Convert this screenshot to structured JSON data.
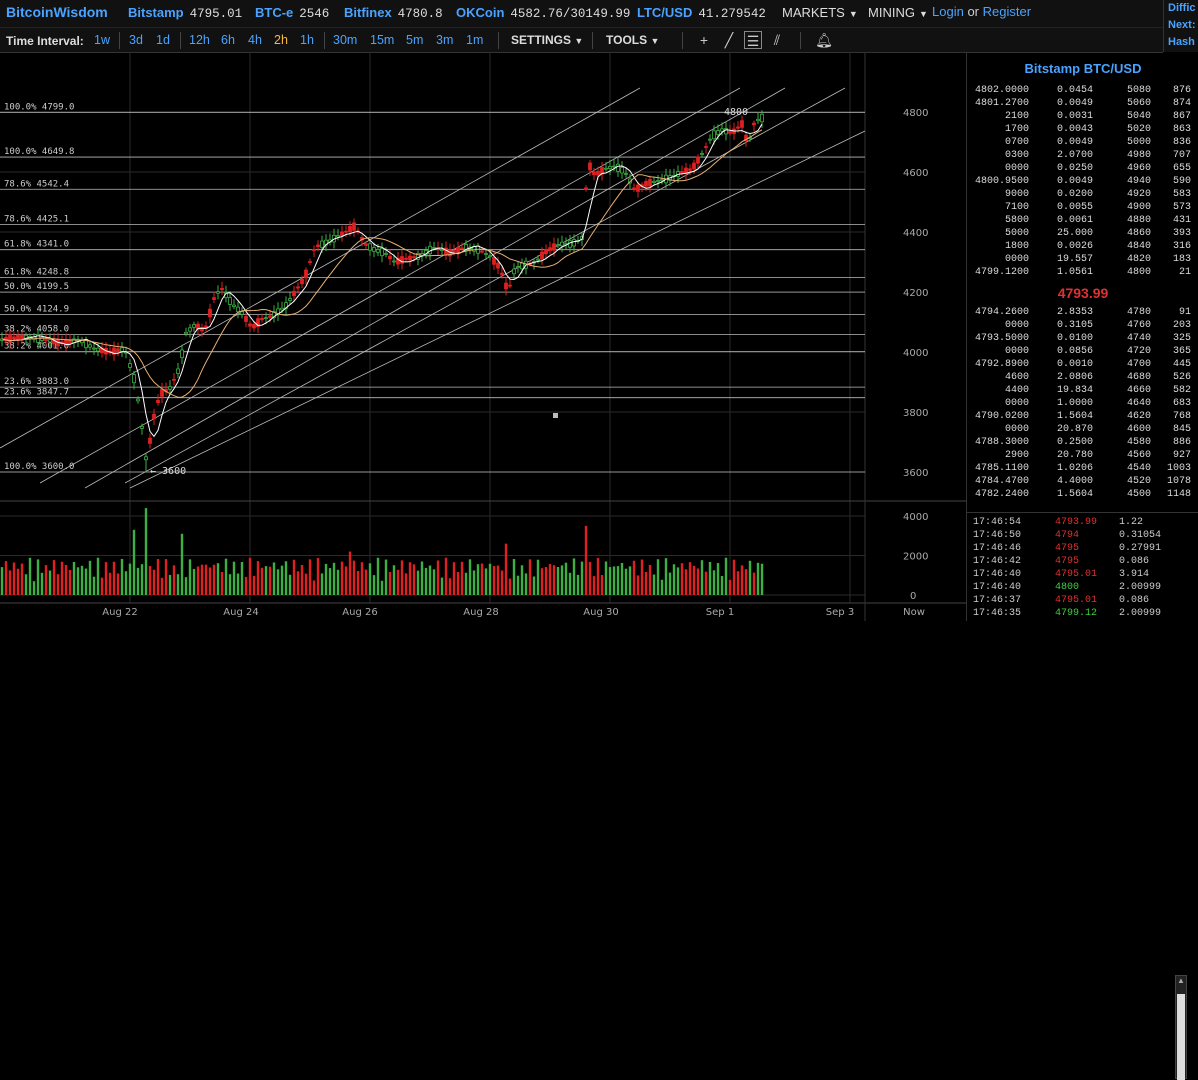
{
  "topbar": {
    "brand": "BitcoinWisdom",
    "exchanges": [
      {
        "name": "Bitstamp",
        "price": "4795.01"
      },
      {
        "name": "BTC-e",
        "price": "2546"
      },
      {
        "name": "Bitfinex",
        "price": "4780.8"
      },
      {
        "name": "OKCoin",
        "price": "4582.76/30149.99"
      },
      {
        "name": "LTC/USD",
        "price": "41.279542"
      }
    ],
    "markets_label": "MARKETS",
    "mining_label": "MINING",
    "login_label": "Login",
    "or_label": "or",
    "register_label": "Register",
    "side_lines": [
      "Diffic",
      "Next:",
      "Hash"
    ]
  },
  "toolbar": {
    "time_interval_label": "Time Interval:",
    "intervals": [
      "1w",
      "3d",
      "1d",
      "12h",
      "6h",
      "4h",
      "2h",
      "1h",
      "30m",
      "15m",
      "5m",
      "3m",
      "1m"
    ],
    "active_interval": "2h",
    "settings_label": "SETTINGS",
    "tools_label": "TOOLS"
  },
  "chart_data": {
    "type": "candlestick",
    "y_ticks": [
      "4800",
      "4600",
      "4400",
      "4200",
      "4000",
      "3800",
      "3600"
    ],
    "x_labels": [
      "Aug 22",
      "Aug 24",
      "Aug 26",
      "Aug 28",
      "Aug 30",
      "Sep 1",
      "Sep 3",
      "Now"
    ],
    "volume_ticks": [
      "4000",
      "2000",
      "0"
    ],
    "ylim": [
      3550,
      4900
    ],
    "volume_ylim": [
      0,
      4600
    ],
    "fib_levels": [
      {
        "label": "100.0% 4799.0",
        "price": 4799.0
      },
      {
        "label": "100.0% 4649.8",
        "price": 4649.8
      },
      {
        "label": "78.6% 4542.4",
        "price": 4542.4
      },
      {
        "label": "78.6% 4425.1",
        "price": 4425.1
      },
      {
        "label": "61.8% 4341.0",
        "price": 4341.0
      },
      {
        "label": "61.8% 4248.8",
        "price": 4248.8
      },
      {
        "label": "50.0% 4199.5",
        "price": 4199.5
      },
      {
        "label": "50.0% 4124.9",
        "price": 4124.9
      },
      {
        "label": "38.2% 4058.0",
        "price": 4058.0
      },
      {
        "label": "38.2% 4001.0",
        "price": 4001.0
      },
      {
        "label": "23.6% 3883.0",
        "price": 3883.0
      },
      {
        "label": "23.6% 3847.7",
        "price": 3847.7
      },
      {
        "label": "100.0% 3600.0",
        "price": 3600.0
      }
    ],
    "high_annotation": "4800",
    "low_annotation": "← 3600",
    "colors": {
      "up": "#3cb043",
      "down": "#e02020",
      "grid": "#2a2a2a",
      "fib": "#bbbbbb",
      "ma_fast": "#ffffff",
      "ma_slow": "#e8b070"
    }
  },
  "orderbook": {
    "title": "Bitstamp BTC/USD",
    "asks": [
      [
        "4802.0000",
        "0.0454",
        "5080",
        "876"
      ],
      [
        "4801.2700",
        "0.0049",
        "5060",
        "874"
      ],
      [
        "2100",
        "0.0031",
        "5040",
        "867"
      ],
      [
        "1700",
        "0.0043",
        "5020",
        "863"
      ],
      [
        "0700",
        "0.0049",
        "5000",
        "836"
      ],
      [
        "0300",
        "2.0700",
        "4980",
        "707"
      ],
      [
        "0000",
        "0.0250",
        "4960",
        "655"
      ],
      [
        "4800.9500",
        "0.0049",
        "4940",
        "590"
      ],
      [
        "9000",
        "0.0200",
        "4920",
        "583"
      ],
      [
        "7100",
        "0.0055",
        "4900",
        "573"
      ],
      [
        "5800",
        "0.0061",
        "4880",
        "431"
      ],
      [
        "5000",
        "25.000",
        "4860",
        "393"
      ],
      [
        "1800",
        "0.0026",
        "4840",
        "316"
      ],
      [
        "0000",
        "19.557",
        "4820",
        "183"
      ],
      [
        "4799.1200",
        "1.0561",
        "4800",
        "21"
      ]
    ],
    "last_price": "4793.99",
    "bids": [
      [
        "4794.2600",
        "2.8353",
        "4780",
        "91"
      ],
      [
        "0000",
        "0.3105",
        "4760",
        "203"
      ],
      [
        "4793.5000",
        "0.0100",
        "4740",
        "325"
      ],
      [
        "0000",
        "0.0856",
        "4720",
        "365"
      ],
      [
        "4792.8900",
        "0.0010",
        "4700",
        "445"
      ],
      [
        "4600",
        "2.0806",
        "4680",
        "526"
      ],
      [
        "4400",
        "19.834",
        "4660",
        "582"
      ],
      [
        "0000",
        "1.0000",
        "4640",
        "683"
      ],
      [
        "4790.0200",
        "1.5604",
        "4620",
        "768"
      ],
      [
        "0000",
        "20.870",
        "4600",
        "845"
      ],
      [
        "4788.3000",
        "0.2500",
        "4580",
        "886"
      ],
      [
        "2900",
        "20.780",
        "4560",
        "927"
      ],
      [
        "4785.1100",
        "1.0206",
        "4540",
        "1003"
      ],
      [
        "4784.4700",
        "4.4000",
        "4520",
        "1078"
      ],
      [
        "4782.2400",
        "1.5604",
        "4500",
        "1148"
      ]
    ]
  },
  "trades": [
    {
      "time": "17:46:54",
      "price": "4793.99",
      "amount": "1.22",
      "side": "sell"
    },
    {
      "time": "17:46:50",
      "price": "4794",
      "amount": "0.31054",
      "side": "sell"
    },
    {
      "time": "17:46:46",
      "price": "4795",
      "amount": "0.27991",
      "side": "sell"
    },
    {
      "time": "17:46:42",
      "price": "4795",
      "amount": "0.086",
      "side": "sell"
    },
    {
      "time": "17:46:40",
      "price": "4795.01",
      "amount": "3.914",
      "side": "sell"
    },
    {
      "time": "17:46:40",
      "price": "4800",
      "amount": "2.00999",
      "side": "buy"
    },
    {
      "time": "17:46:37",
      "price": "4795.01",
      "amount": "0.086",
      "side": "sell"
    },
    {
      "time": "17:46:35",
      "price": "4799.12",
      "amount": "2.00999",
      "side": "buy"
    }
  ]
}
